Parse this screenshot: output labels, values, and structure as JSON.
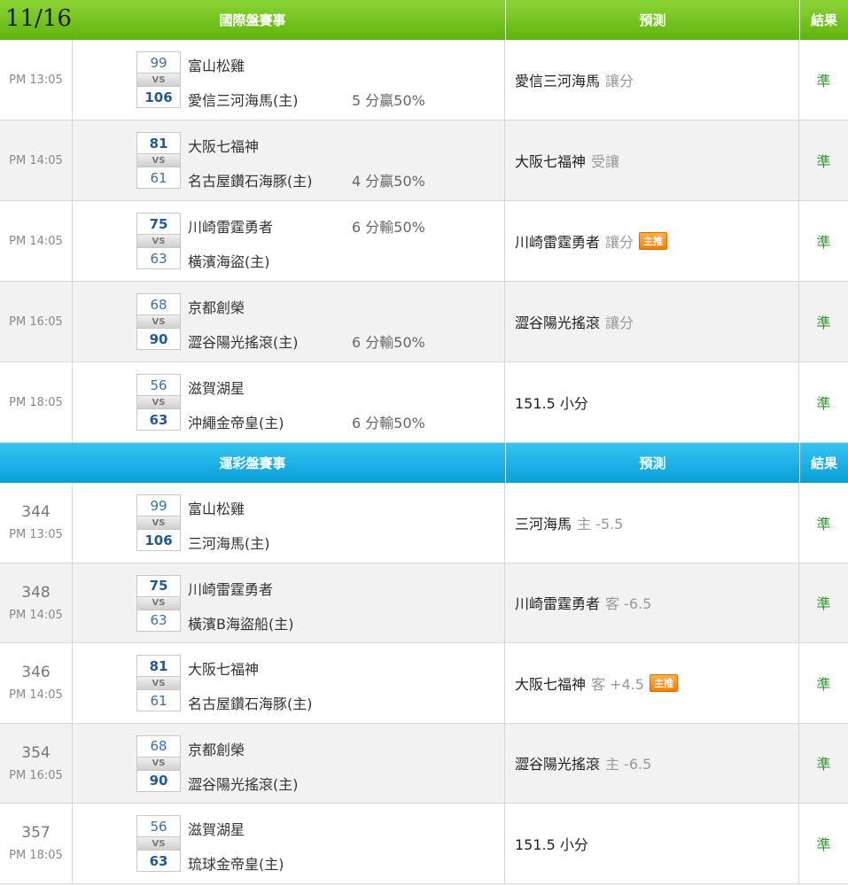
{
  "section1": {
    "date": "11/16",
    "title": "國際盤賽事",
    "prediction_header": "預測",
    "result_header": "結果",
    "rows": [
      {
        "time": "PM 13:05",
        "away": "富山松雞",
        "home": "愛信三河海馬(主)",
        "away_score": "99",
        "home_score": "106",
        "winner": "home",
        "vs": "VS",
        "spread_top": "",
        "spread_bottom": "5 分贏50%",
        "pick": "愛信三河海馬",
        "pick_type": "讓分",
        "badge": "",
        "result": "準"
      },
      {
        "time": "PM 14:05",
        "away": "大阪七福神",
        "home": "名古屋鑽石海豚(主)",
        "away_score": "81",
        "home_score": "61",
        "winner": "away",
        "vs": "VS",
        "spread_top": "",
        "spread_bottom": "4 分贏50%",
        "pick": "大阪七福神",
        "pick_type": "受讓",
        "badge": "",
        "result": "準"
      },
      {
        "time": "PM 14:05",
        "away": "川崎雷霆勇者",
        "home": "橫濱海盜(主)",
        "away_score": "75",
        "home_score": "63",
        "winner": "away",
        "vs": "VS",
        "spread_top": "6 分輸50%",
        "spread_bottom": "",
        "pick": "川崎雷霆勇者",
        "pick_type": "讓分",
        "badge": "主推",
        "result": "準"
      },
      {
        "time": "PM 16:05",
        "away": "京都創榮",
        "home": "澀谷陽光搖滾(主)",
        "away_score": "68",
        "home_score": "90",
        "winner": "home",
        "vs": "VS",
        "spread_top": "",
        "spread_bottom": "6 分輸50%",
        "pick": "澀谷陽光搖滾",
        "pick_type": "讓分",
        "badge": "",
        "result": "準"
      },
      {
        "time": "PM 18:05",
        "away": "滋賀湖星",
        "home": "沖繩金帝皇(主)",
        "away_score": "56",
        "home_score": "63",
        "winner": "home",
        "vs": "VS",
        "spread_top": "",
        "spread_bottom": "6 分輸50%",
        "pick": "151.5 小分",
        "pick_type": "",
        "badge": "",
        "result": "準"
      }
    ]
  },
  "section2": {
    "title": "運彩盤賽事",
    "prediction_header": "預測",
    "result_header": "結果",
    "rows": [
      {
        "num": "344",
        "time": "PM 13:05",
        "away": "富山松雞",
        "home": "三河海馬(主)",
        "away_score": "99",
        "home_score": "106",
        "winner": "home",
        "vs": "VS",
        "pick": "三河海馬",
        "pick_type": "主 -5.5",
        "badge": "",
        "result": "準"
      },
      {
        "num": "348",
        "time": "PM 14:05",
        "away": "川崎雷霆勇者",
        "home": "橫濱B海盜船(主)",
        "away_score": "75",
        "home_score": "63",
        "winner": "away",
        "vs": "VS",
        "pick": "川崎雷霆勇者",
        "pick_type": "客 -6.5",
        "badge": "",
        "result": "準"
      },
      {
        "num": "346",
        "time": "PM 14:05",
        "away": "大阪七福神",
        "home": "名古屋鑽石海豚(主)",
        "away_score": "81",
        "home_score": "61",
        "winner": "away",
        "vs": "VS",
        "pick": "大阪七福神",
        "pick_type": "客 +4.5",
        "badge": "主推",
        "result": "準"
      },
      {
        "num": "354",
        "time": "PM 16:05",
        "away": "京都創榮",
        "home": "澀谷陽光搖滾(主)",
        "away_score": "68",
        "home_score": "90",
        "winner": "home",
        "vs": "VS",
        "pick": "澀谷陽光搖滾",
        "pick_type": "主 -6.5",
        "badge": "",
        "result": "準"
      },
      {
        "num": "357",
        "time": "PM 18:05",
        "away": "滋賀湖星",
        "home": "琉球金帝皇(主)",
        "away_score": "56",
        "home_score": "63",
        "winner": "home",
        "vs": "VS",
        "pick": "151.5 小分",
        "pick_type": "",
        "badge": "",
        "result": "準"
      }
    ]
  },
  "colors": {
    "green_header": "#6cc01b",
    "blue_header": "#1ab0e6",
    "result_green": "#2a9a2a",
    "badge_orange": "#f0800a"
  }
}
